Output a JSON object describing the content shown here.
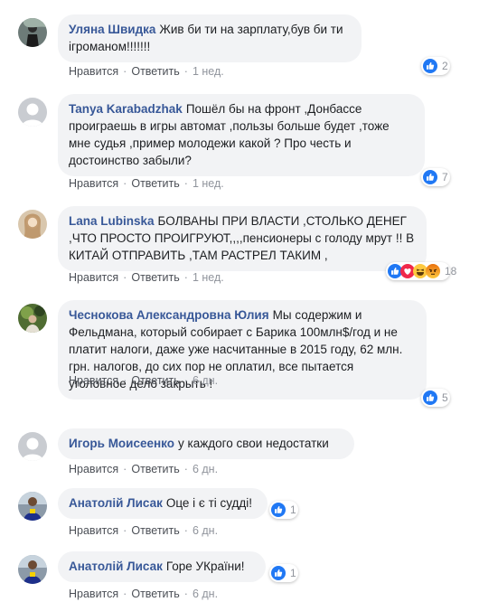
{
  "actions": {
    "like": "Нравится",
    "reply": "Ответить",
    "dot": "·"
  },
  "comments": [
    {
      "author": "Уляна Швидка",
      "text_lines": [
        "Жив би ти на зарплату,був би ти",
        "ігроманом!!!!!!!"
      ],
      "time": "1 нед.",
      "reactions": "2"
    },
    {
      "author": "Tanya Karabadzhak",
      "text_lines": [
        "Пошёл бы на фронт ,Донбассе",
        "проиграешь в игры автомат ,пользы больше будет ,тоже",
        "мне судья ,пример молодежи какой ? Про честь и",
        "достоинство забыли?"
      ],
      "time": "1 нед.",
      "reactions": "7"
    },
    {
      "author": "Lana Lubinska",
      "text_lines": [
        "БОЛВАНЫ ПРИ ВЛАСТИ ,СТОЛЬКО ДЕНЕГ",
        ",ЧТО ПРОСТО ПРОИГРУЮТ,,,,пенсионеры с голоду мрут !! В",
        "КИТАЙ ОТПРАВИТЬ ,ТАМ РАСТРЕЛ ТАКИМ ,"
      ],
      "time": "1 нед.",
      "reactions": "18"
    },
    {
      "author": "Чеснокова Александровна Юлия",
      "text_lines": [
        "Мы содержим и",
        "Фельдмана, который собирает с Барика 100млн$/год и не",
        "платит налоги, даже уже насчитанные в 2015 году, 62 млн.",
        "грн. налогов, до сих пор не оплатил, все пытается",
        "уголовное дело закрыть !"
      ],
      "time": "6 дн.",
      "reactions": "5"
    },
    {
      "author": "Игорь Моисеенко",
      "text_lines": [
        "у каждого свои недостатки"
      ],
      "time": "6 дн.",
      "reactions": ""
    },
    {
      "author": "Анатолій Лисак",
      "text_lines": [
        "Оце і є ті судді!"
      ],
      "time": "6 дн.",
      "reactions": "1"
    },
    {
      "author": "Анатолій Лисак",
      "text_lines": [
        "Горе УКраїни!"
      ],
      "time": "6 дн.",
      "reactions": "1"
    }
  ],
  "colors": {
    "link": "#385898",
    "like_blue": "#2078f4",
    "love_red": "#f0284a",
    "haha_yellow": "#fdc940",
    "angry_orange": "#e9710f"
  },
  "icons": {
    "like": "thumbs-up-icon",
    "love": "heart-icon",
    "haha": "laughing-face-icon",
    "angry": "angry-face-icon"
  }
}
